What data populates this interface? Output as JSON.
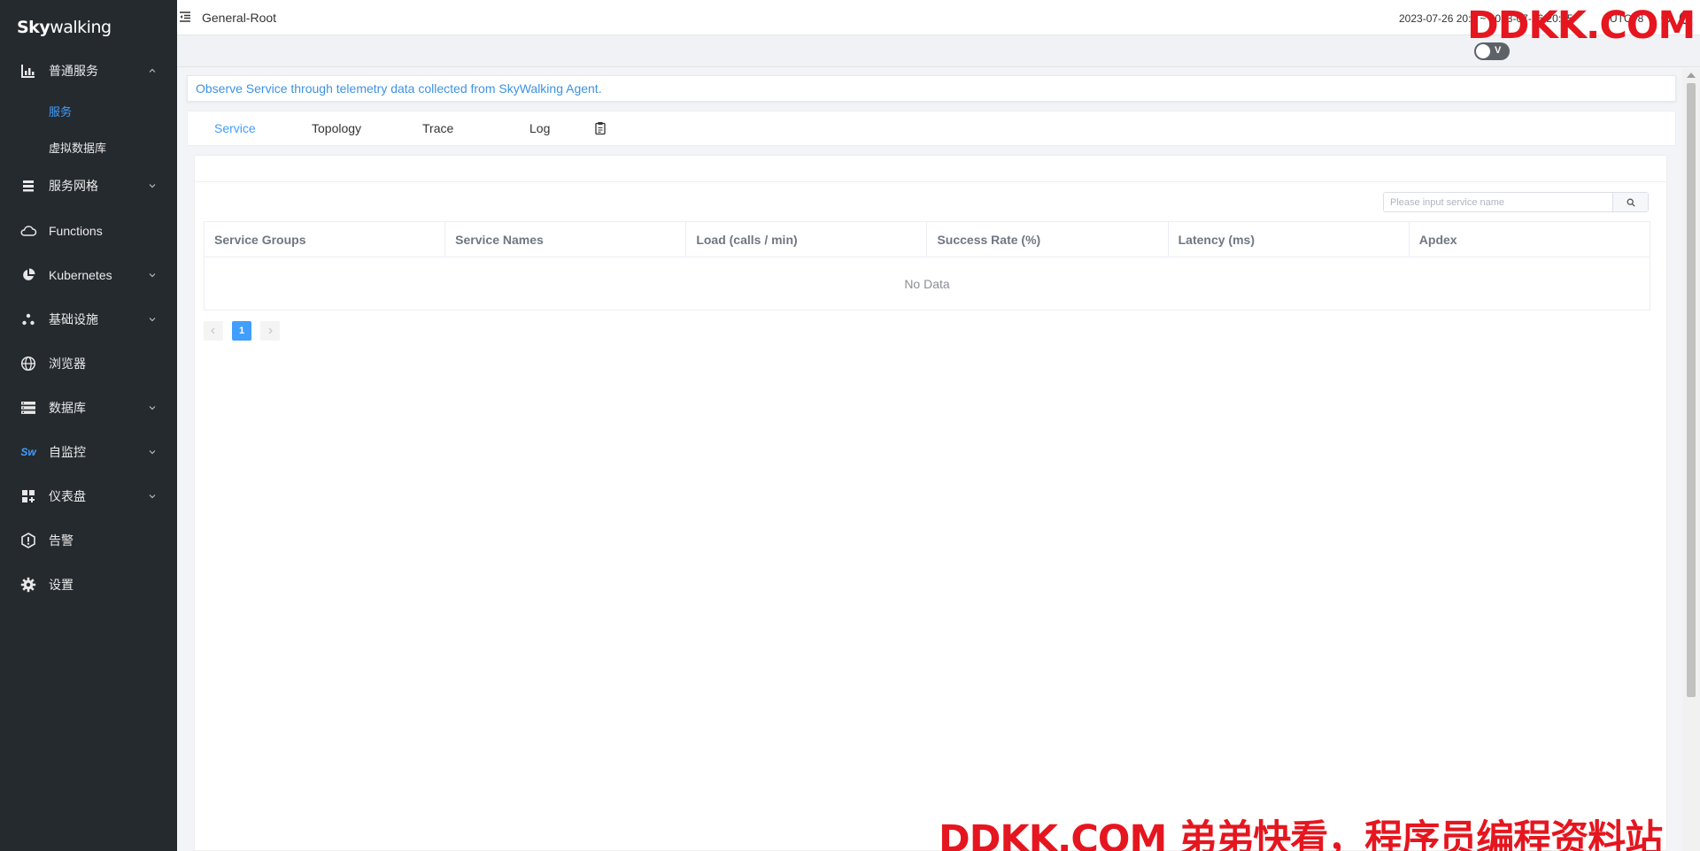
{
  "app": {
    "logo": "Skywalking"
  },
  "sidebar": {
    "items": [
      {
        "label": "普通服务",
        "icon": "bar-chart-icon",
        "expanded": true
      },
      {
        "label": "服务",
        "sub": true,
        "active": true
      },
      {
        "label": "虚拟数据库",
        "sub": true
      },
      {
        "label": "服务网格",
        "icon": "layers-icon"
      },
      {
        "label": "Functions",
        "icon": "cloud-icon"
      },
      {
        "label": "Kubernetes",
        "icon": "pie-icon"
      },
      {
        "label": "基础设施",
        "icon": "dots-icon"
      },
      {
        "label": "浏览器",
        "icon": "globe-icon"
      },
      {
        "label": "数据库",
        "icon": "database-icon"
      },
      {
        "label": "自监控",
        "icon": "sw-icon",
        "icon_text": "Sw"
      },
      {
        "label": "仪表盘",
        "icon": "dashboard-icon"
      },
      {
        "label": "告警",
        "icon": "alert-icon"
      },
      {
        "label": "设置",
        "icon": "gear-icon"
      }
    ]
  },
  "header": {
    "title": "General-Root",
    "time_range": "2023-07-26 20:1 ~ 2023-07-26 20:45",
    "timezone": "UTC+8",
    "toggle_label": "V"
  },
  "main": {
    "info": "Observe Service through telemetry data collected from SkyWalking Agent.",
    "tabs": [
      {
        "label": "Service",
        "active": true
      },
      {
        "label": "Topology"
      },
      {
        "label": "Trace"
      },
      {
        "label": "Log"
      }
    ],
    "search_placeholder": "Please input service name",
    "table": {
      "columns": [
        "Service Groups",
        "Service Names",
        "Load (calls / min)",
        "Success Rate (%)",
        "Latency (ms)",
        "Apdex"
      ],
      "empty_text": "No Data"
    },
    "pagination": {
      "current": "1"
    }
  },
  "watermark": {
    "top": "DDKK.COM",
    "bottom": "DDKK.COM 弟弟快看，程序员编程资料站"
  },
  "colors": {
    "sidebar_bg": "#252a2f",
    "accent": "#409eff",
    "watermark": "#e5161f"
  }
}
